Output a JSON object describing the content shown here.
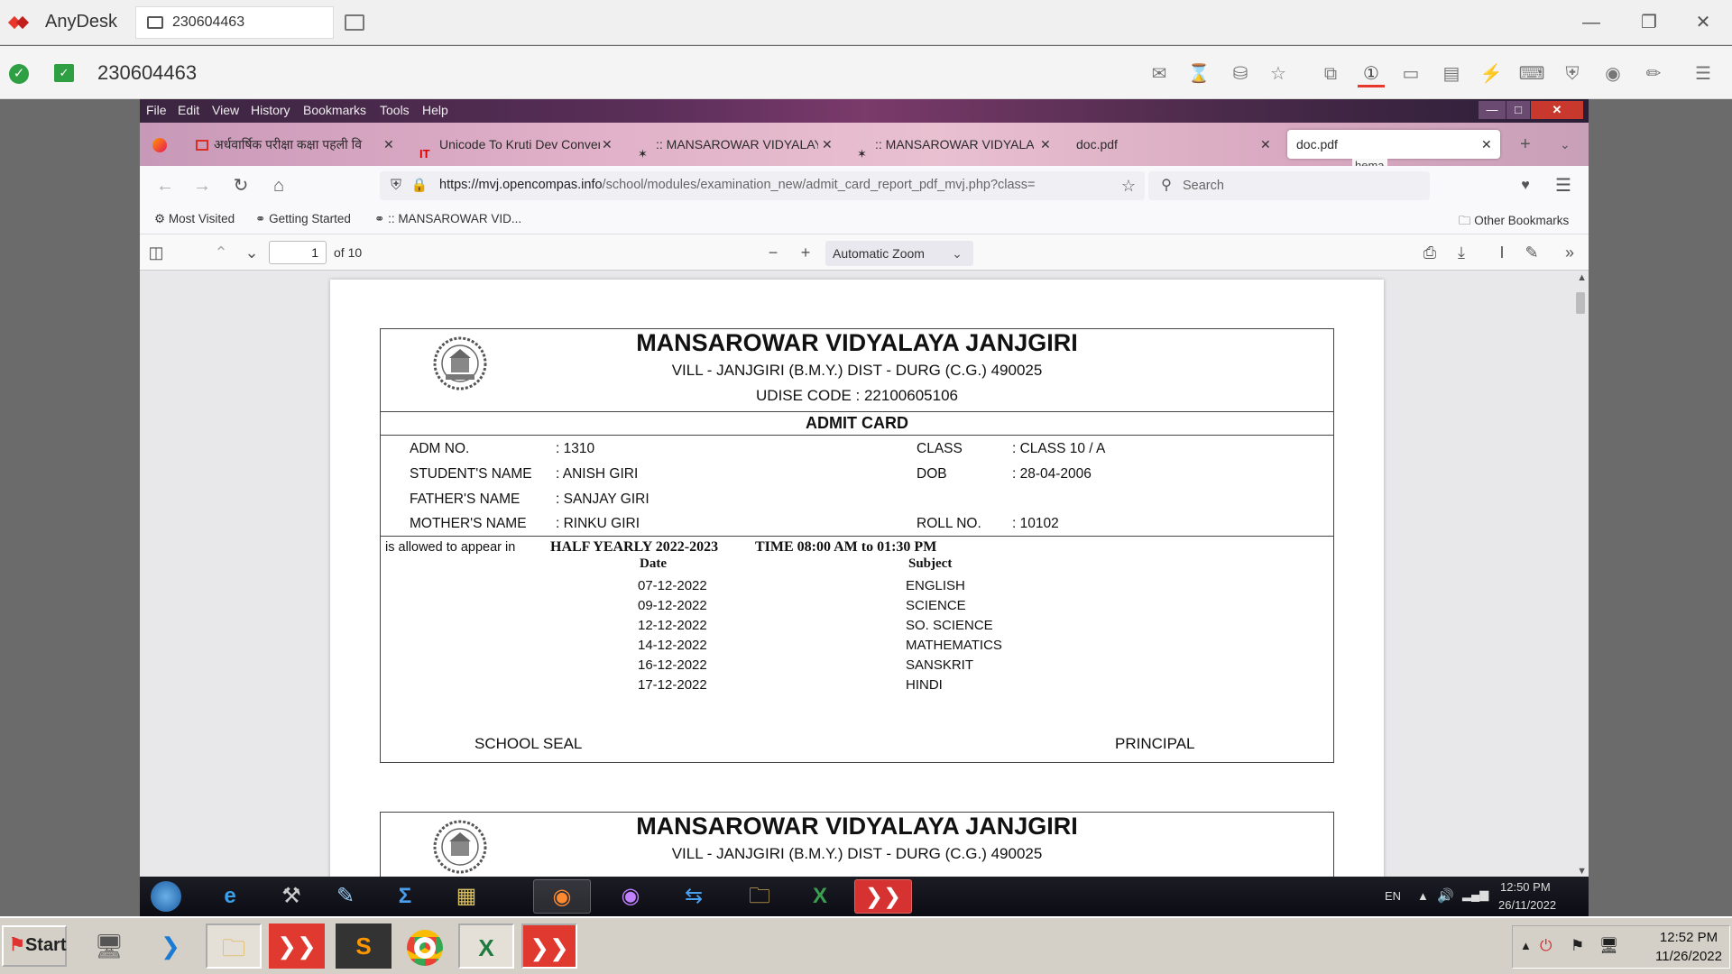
{
  "anydesk": {
    "app_name": "AnyDesk",
    "tab_id": "230604463",
    "toolbar_id": "230604463",
    "colors": {
      "accent": "#e8382c",
      "online": "#2ea043"
    }
  },
  "firefox": {
    "menu": [
      "File",
      "Edit",
      "View",
      "History",
      "Bookmarks",
      "Tools",
      "Help"
    ],
    "tabs": [
      {
        "label": "अर्धवार्षिक परीक्षा कक्षा पहली वि"
      },
      {
        "label": "Unicode To Kruti Dev Conver"
      },
      {
        "label": ":: MANSAROWAR VIDYALAYA"
      },
      {
        "label": ":: MANSAROWAR VIDYALAYA"
      },
      {
        "label": "doc.pdf"
      },
      {
        "label": "doc.pdf"
      }
    ],
    "tooltip": "hema",
    "url_host": "https://mvj.opencompas.info",
    "url_path": "/school/modules/examination_new/admit_card_report_pdf_mvj.php?class=",
    "search_placeholder": "Search",
    "bookmarks": [
      "Most Visited",
      "Getting Started",
      ":: MANSAROWAR VID...",
      "Other Bookmarks"
    ]
  },
  "pdf": {
    "page": "1",
    "of_pages": "of 10",
    "zoom": "Automatic Zoom"
  },
  "card": {
    "school_name": "MANSAROWAR VIDYALAYA JANJGIRI",
    "address": "VILL - JANJGIRI (B.M.Y.) DIST - DURG (C.G.) 490025",
    "udise": "UDISE CODE : 22100605106",
    "title": "ADMIT CARD",
    "fields": {
      "adm_label": "ADM NO.",
      "adm_value": ": 1310",
      "class_label": "CLASS",
      "class_value": ": CLASS 10 / A",
      "student_label": "STUDENT'S NAME",
      "student_value": ": ANISH GIRI",
      "dob_label": "DOB",
      "dob_value": ": 28-04-2006",
      "father_label": "FATHER'S NAME",
      "father_value": ": SANJAY GIRI",
      "mother_label": "MOTHER'S NAME",
      "mother_value": ": RINKU GIRI",
      "roll_label": "ROLL NO.",
      "roll_value": ": 10102"
    },
    "allowed_text": "is allowed to appear in",
    "exam_name": "HALF YEARLY 2022-2023",
    "exam_time": "TIME 08:00 AM to 01:30 PM",
    "date_header": "Date",
    "subject_header": "Subject",
    "schedule": [
      {
        "date": "07-12-2022",
        "subject": "ENGLISH"
      },
      {
        "date": "09-12-2022",
        "subject": "SCIENCE"
      },
      {
        "date": "12-12-2022",
        "subject": "SO. SCIENCE"
      },
      {
        "date": "14-12-2022",
        "subject": "MATHEMATICS"
      },
      {
        "date": "16-12-2022",
        "subject": "SANSKRIT"
      },
      {
        "date": "17-12-2022",
        "subject": "HINDI"
      }
    ],
    "seal_label": "SCHOOL SEAL",
    "principal_label": "PRINCIPAL"
  },
  "remote_taskbar": {
    "lang": "EN",
    "time": "12:50 PM",
    "date": "26/11/2022"
  },
  "local_taskbar": {
    "start": "Start",
    "time": "12:52 PM",
    "date": "11/26/2022"
  }
}
